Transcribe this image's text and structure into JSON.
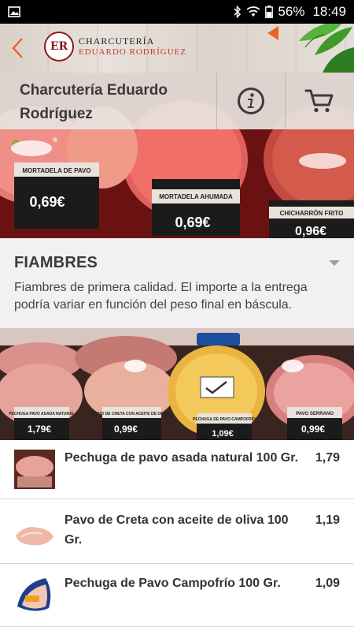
{
  "status_bar": {
    "battery": "56%",
    "time": "18:49",
    "icons": [
      "image-notification-icon",
      "bluetooth-icon",
      "wifi-icon",
      "battery-icon"
    ]
  },
  "app_bar": {
    "back_icon": "chevron-left-icon",
    "brand_line1": "CHARCUTERÍA",
    "brand_line2": "EDUARDO RODRÍGUEZ",
    "logo_text": "ER",
    "accent_color": "#e8632a"
  },
  "store": {
    "title_line1": "Charcutería Eduardo",
    "title_line2": "Rodríguez",
    "info_icon": "info-icon",
    "cart_icon": "cart-icon"
  },
  "hero_labels": [
    "MORTADELA DE PAVO",
    "0,69€",
    "MORTADELA AHUMADA",
    "0,69€",
    "CHICHARRÓN FRITO",
    "0,96€"
  ],
  "category": {
    "title": "FIAMBRES",
    "description": "Fiambres de primera calidad. El importe a la entrega podría variar en función del peso final en báscula."
  },
  "banner_labels": [
    "PECHUGA PAVO ASADA NATURAL",
    "1,79€",
    "PAVO DE CRETA CON ACEITE DE OLIVA",
    "0,99€",
    "PECHUGA DE PAVO CAMPOFRÍO",
    "1,09€",
    "PAVO SERRANO",
    "0,99€"
  ],
  "products": [
    {
      "name": "Pechuga de pavo asada natural 100 Gr.",
      "price": "1,79"
    },
    {
      "name": "Pavo de Creta con aceite de oliva 100 Gr.",
      "price": "1,19"
    },
    {
      "name": "Pechuga de Pavo Campofrío 100 Gr.",
      "price": "1,09"
    }
  ]
}
